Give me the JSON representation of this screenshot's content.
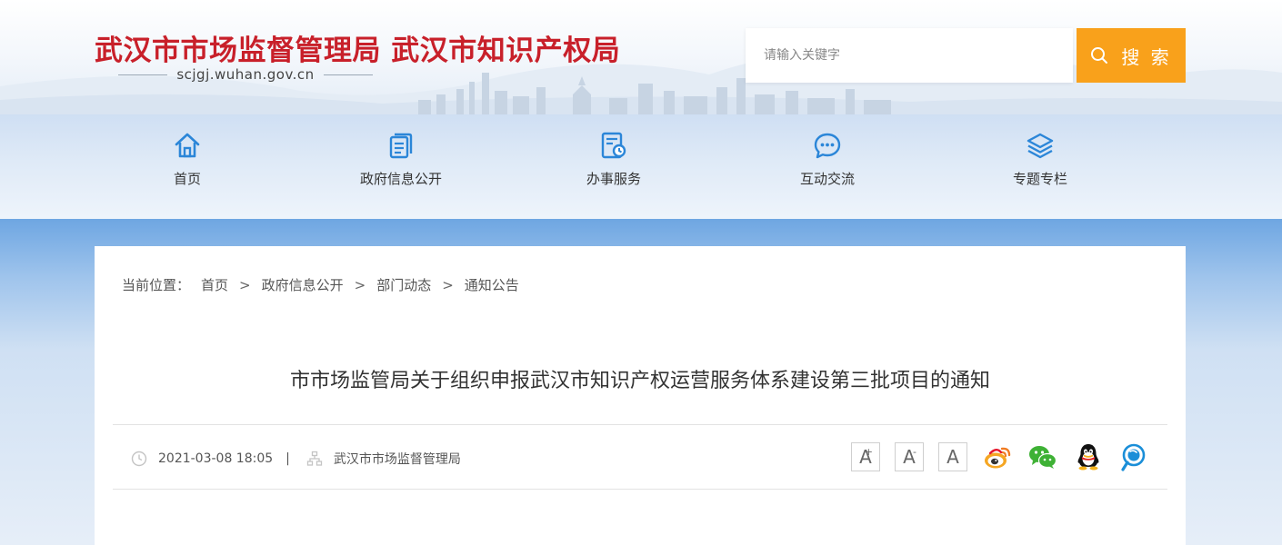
{
  "header": {
    "site_title": "武汉市市场监督管理局 武汉市知识产权局",
    "domain": "scjgj.wuhan.gov.cn",
    "search_placeholder": "请输入关键字",
    "search_button": "搜 索"
  },
  "nav": {
    "items": [
      {
        "label": "首页",
        "icon": "home-icon"
      },
      {
        "label": "政府信息公开",
        "icon": "document-icon"
      },
      {
        "label": "办事服务",
        "icon": "service-icon"
      },
      {
        "label": "互动交流",
        "icon": "chat-icon"
      },
      {
        "label": "专题专栏",
        "icon": "layers-icon"
      }
    ]
  },
  "breadcrumb": {
    "prefix": "当前位置：",
    "items": [
      "首页",
      "政府信息公开",
      "部门动态",
      "通知公告"
    ],
    "separator": ">"
  },
  "article": {
    "title": "市市场监管局关于组织申报武汉市知识产权运营服务体系建设第三批项目的通知",
    "date": "2021-03-08 18:05",
    "source": "武汉市市场监督管理局"
  },
  "tools": {
    "font_increase": "A",
    "font_decrease": "A",
    "font_reset": "A",
    "font_increase_mark": "+",
    "font_decrease_mark": "-",
    "share_icons": [
      "weibo-icon",
      "wechat-icon",
      "qq-icon",
      "qzone-icon"
    ]
  },
  "colors": {
    "title_red": "#c8202a",
    "search_orange": "#f9a11b",
    "nav_icon_blue": "#2b86d8"
  }
}
